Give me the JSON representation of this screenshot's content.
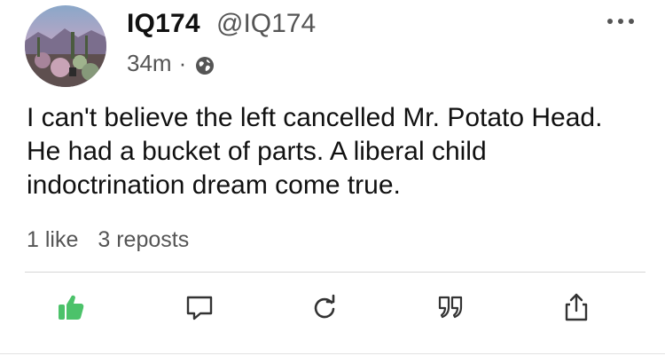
{
  "author": {
    "display_name": "IQ174",
    "handle": "@IQ174"
  },
  "meta": {
    "time_ago": "34m",
    "separator": "·",
    "visibility_icon": "globe-icon"
  },
  "post": {
    "text": "I can't believe the left cancelled Mr. Potato Head. He had a bucket of parts. A liberal child indoctrination dream come true."
  },
  "stats": {
    "likes": "1 like",
    "reposts": "3 reposts"
  },
  "actions": [
    {
      "name": "like",
      "icon": "thumbs-up-icon",
      "active": true,
      "color": "#4cc26a"
    },
    {
      "name": "comment",
      "icon": "comment-icon",
      "active": false
    },
    {
      "name": "repost",
      "icon": "repost-icon",
      "active": false
    },
    {
      "name": "quote",
      "icon": "quote-icon",
      "active": false
    },
    {
      "name": "share",
      "icon": "share-icon",
      "active": false
    }
  ],
  "colors": {
    "text_primary": "#111111",
    "text_secondary": "#555555",
    "like_active": "#4cc26a",
    "icon_default": "#333333"
  }
}
